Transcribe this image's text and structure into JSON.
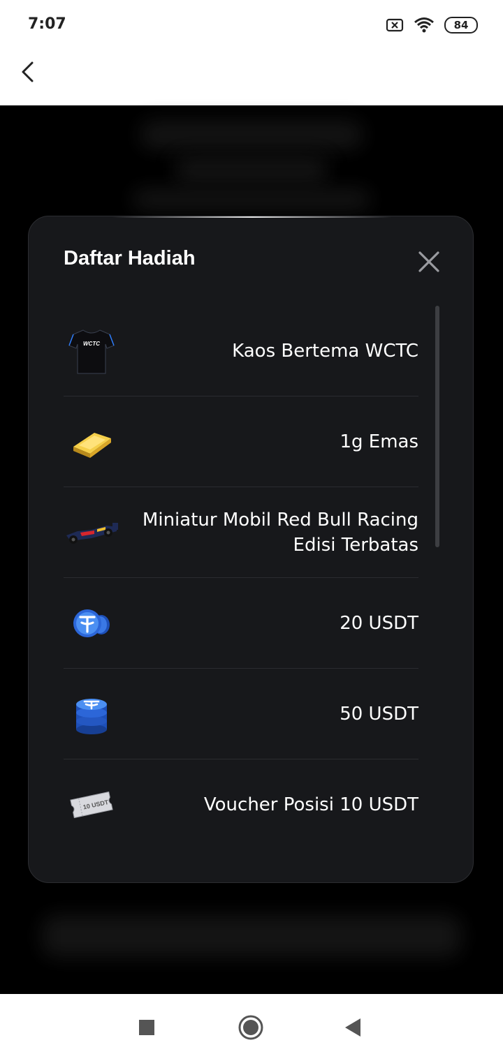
{
  "status_bar": {
    "time": "7:07",
    "battery": "84"
  },
  "modal": {
    "title": "Daftar Hadiah",
    "prizes": [
      {
        "icon": "tshirt-icon",
        "shirt_text": "WCTC",
        "label": "Kaos Bertema WCTC"
      },
      {
        "icon": "gold-bar-icon",
        "label": "1g Emas"
      },
      {
        "icon": "race-car-icon",
        "label": "Miniatur Mobil Red Bull Racing Edisi Terbatas"
      },
      {
        "icon": "usdt-coins-icon",
        "label": "20 USDT"
      },
      {
        "icon": "usdt-coin-stack-icon",
        "label": "50 USDT"
      },
      {
        "icon": "voucher-ticket-icon",
        "ticket_text": "10 USDT",
        "label": "Voucher Posisi 10 USDT"
      }
    ]
  },
  "colors": {
    "modal_bg": "#17181b",
    "backdrop": "#000000",
    "text": "#ffffff"
  }
}
